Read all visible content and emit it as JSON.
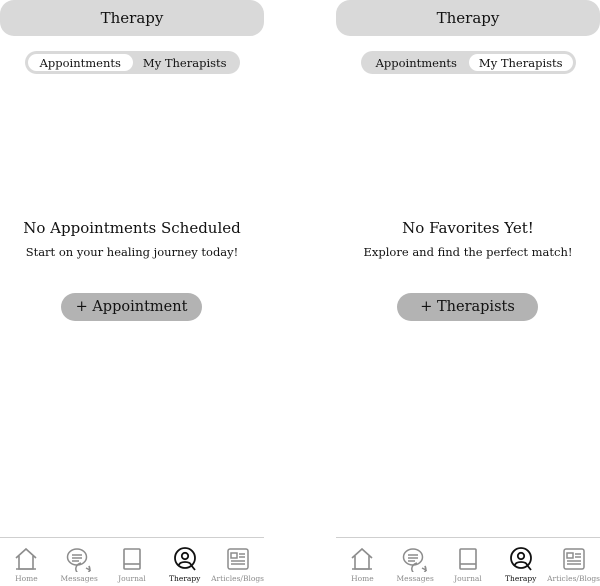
{
  "screens": [
    {
      "header": {
        "title": "Therapy"
      },
      "toggle": {
        "options": [
          "Appointments",
          "My Therapists"
        ],
        "active_index": 0
      },
      "empty_state": {
        "title": "No Appointments Scheduled",
        "subtitle": "Start on your healing journey today!",
        "cta_label": "+ Appointment"
      }
    },
    {
      "header": {
        "title": "Therapy"
      },
      "toggle": {
        "options": [
          "Appointments",
          "My Therapists"
        ],
        "active_index": 1
      },
      "empty_state": {
        "title": "No Favorites Yet!",
        "subtitle": "Explore and find the perfect match!",
        "cta_label": "+ Therapists"
      }
    }
  ],
  "tabbar": {
    "items": [
      {
        "label": "Home",
        "icon": "home-icon"
      },
      {
        "label": "Messages",
        "icon": "messages-icon"
      },
      {
        "label": "Journal",
        "icon": "journal-icon"
      },
      {
        "label": "Therapy",
        "icon": "therapy-icon"
      },
      {
        "label": "Articles/Blogs",
        "icon": "articles-icon"
      }
    ],
    "active_label": "Therapy"
  },
  "colors": {
    "header_bg": "#d9d9d9",
    "button_bg": "#b3b3b3",
    "inactive_tab": "#8c8c8c",
    "active_tab": "#111111"
  }
}
